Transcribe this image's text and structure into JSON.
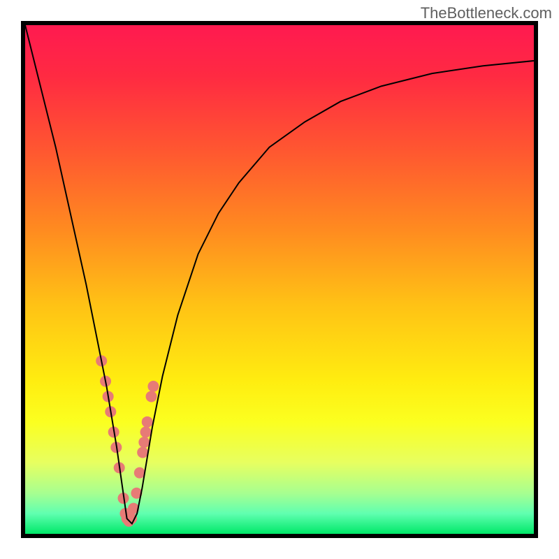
{
  "watermark": "TheBottleneck.com",
  "chart_data": {
    "type": "line",
    "title": "",
    "xlabel": "",
    "ylabel": "",
    "x_range": [
      0,
      100
    ],
    "y_range_percent": [
      0,
      100
    ],
    "gradient_stops": [
      {
        "pos": 0.0,
        "color": "#ff1a50"
      },
      {
        "pos": 0.1,
        "color": "#ff2a42"
      },
      {
        "pos": 0.25,
        "color": "#ff5830"
      },
      {
        "pos": 0.4,
        "color": "#ff8a20"
      },
      {
        "pos": 0.55,
        "color": "#ffc215"
      },
      {
        "pos": 0.7,
        "color": "#ffed10"
      },
      {
        "pos": 0.78,
        "color": "#fbff20"
      },
      {
        "pos": 0.86,
        "color": "#e7ff60"
      },
      {
        "pos": 0.92,
        "color": "#a7ff90"
      },
      {
        "pos": 0.96,
        "color": "#60ffb0"
      },
      {
        "pos": 1.0,
        "color": "#00e869"
      }
    ],
    "curve_minimum_x": 20,
    "series": [
      {
        "name": "bottleneck-curve",
        "x": [
          0,
          2,
          4,
          6,
          8,
          10,
          12,
          14,
          15,
          16,
          17,
          18,
          19,
          20,
          21,
          22,
          23,
          24,
          25,
          27,
          30,
          34,
          38,
          42,
          48,
          55,
          62,
          70,
          80,
          90,
          100
        ],
        "y_percent": [
          100,
          92,
          84,
          76,
          67,
          58,
          49,
          39,
          34,
          29,
          23,
          17,
          10,
          3,
          2,
          4,
          9,
          15,
          21,
          31,
          43,
          55,
          63,
          69,
          76,
          81,
          85,
          88,
          90.5,
          92,
          93
        ]
      }
    ],
    "markers": {
      "name": "highlight-dots",
      "color": "#e77b76",
      "points": [
        {
          "x": 15.0,
          "y_percent": 34
        },
        {
          "x": 15.8,
          "y_percent": 30
        },
        {
          "x": 16.3,
          "y_percent": 27
        },
        {
          "x": 16.8,
          "y_percent": 24
        },
        {
          "x": 17.4,
          "y_percent": 20
        },
        {
          "x": 17.9,
          "y_percent": 17
        },
        {
          "x": 18.5,
          "y_percent": 13
        },
        {
          "x": 19.3,
          "y_percent": 7
        },
        {
          "x": 19.7,
          "y_percent": 4
        },
        {
          "x": 20.0,
          "y_percent": 3
        },
        {
          "x": 20.4,
          "y_percent": 2.5
        },
        {
          "x": 20.9,
          "y_percent": 3
        },
        {
          "x": 21.3,
          "y_percent": 5
        },
        {
          "x": 21.9,
          "y_percent": 8
        },
        {
          "x": 22.5,
          "y_percent": 12
        },
        {
          "x": 23.1,
          "y_percent": 16
        },
        {
          "x": 23.4,
          "y_percent": 18
        },
        {
          "x": 23.7,
          "y_percent": 20
        },
        {
          "x": 24.0,
          "y_percent": 22
        },
        {
          "x": 24.8,
          "y_percent": 27
        },
        {
          "x": 25.2,
          "y_percent": 29
        }
      ]
    }
  }
}
